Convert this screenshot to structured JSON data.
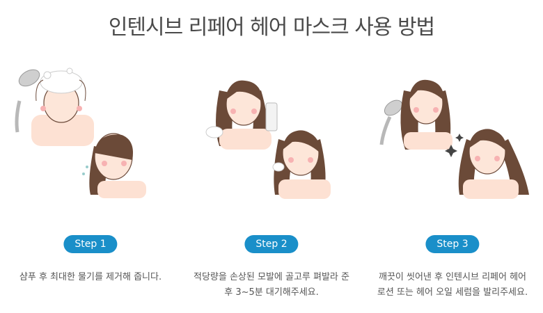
{
  "title": "인텐시브 리페어 헤어 마스크 사용 방법",
  "accent_color": "#1a8fc9",
  "steps": [
    {
      "badge": "Step 1",
      "lines": [
        "샴푸 후 최대한 물기를 제거해 줍니다."
      ],
      "icons": [
        "shower-head-icon",
        "woman-washing-hair-icon",
        "woman-squeezing-hair-icon"
      ]
    },
    {
      "badge": "Step 2",
      "lines": [
        "적당량을 손상된 모발에 골고루 펴발라 준",
        "후 3~5분 대기해주세요."
      ],
      "icons": [
        "woman-with-tube-icon",
        "woman-applying-mask-icon"
      ]
    },
    {
      "badge": "Step 3",
      "lines": [
        "깨끗이 씻어낸 후 인텐시브 리페어 헤어",
        "로션 또는 헤어 오일 세럼을 발리주세요."
      ],
      "icons": [
        "woman-rinsing-hair-icon",
        "woman-shiny-hair-icon"
      ]
    }
  ]
}
